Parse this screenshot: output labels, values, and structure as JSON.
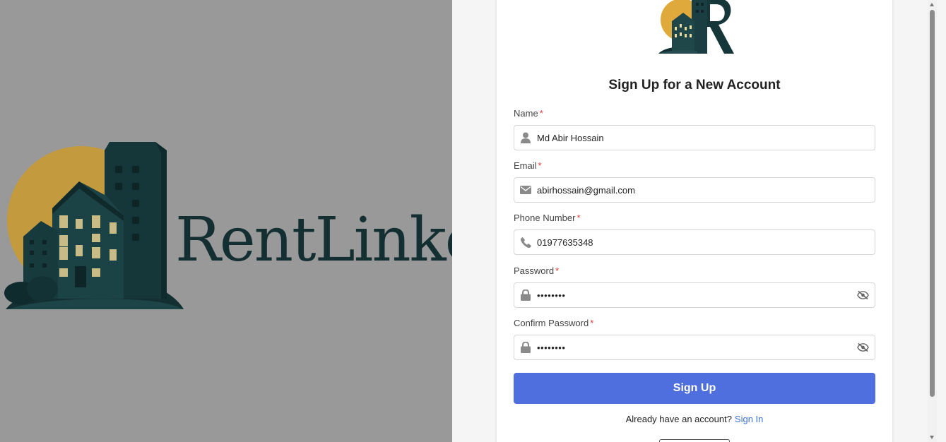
{
  "brand": {
    "name": "RentLinker"
  },
  "form": {
    "title": "Sign Up for a New Account",
    "required_mark": "*",
    "name": {
      "label": "Name",
      "value": "Md Abir Hossain",
      "icon": "user-icon"
    },
    "email": {
      "label": "Email",
      "value": "abirhossain@gmail.com",
      "icon": "envelope-icon"
    },
    "phone": {
      "label": "Phone Number",
      "value": "01977635348",
      "icon": "phone-icon"
    },
    "password": {
      "label": "Password",
      "value": "abcd1234",
      "icon": "lock-icon",
      "toggle_icon": "eye-slash-icon"
    },
    "confirm_password": {
      "label": "Confirm Password",
      "value": "abcd1234",
      "icon": "lock-icon",
      "toggle_icon": "eye-slash-icon"
    },
    "submit_label": "Sign Up",
    "signin_prompt": "Already have an account?",
    "signin_link": "Sign In"
  },
  "colors": {
    "primary_button": "#4f6fde",
    "link": "#3f74d6",
    "required": "#e53935",
    "brand_dark": "#1d3f42",
    "brand_sun": "#e0a93b",
    "left_background": "#999999"
  }
}
